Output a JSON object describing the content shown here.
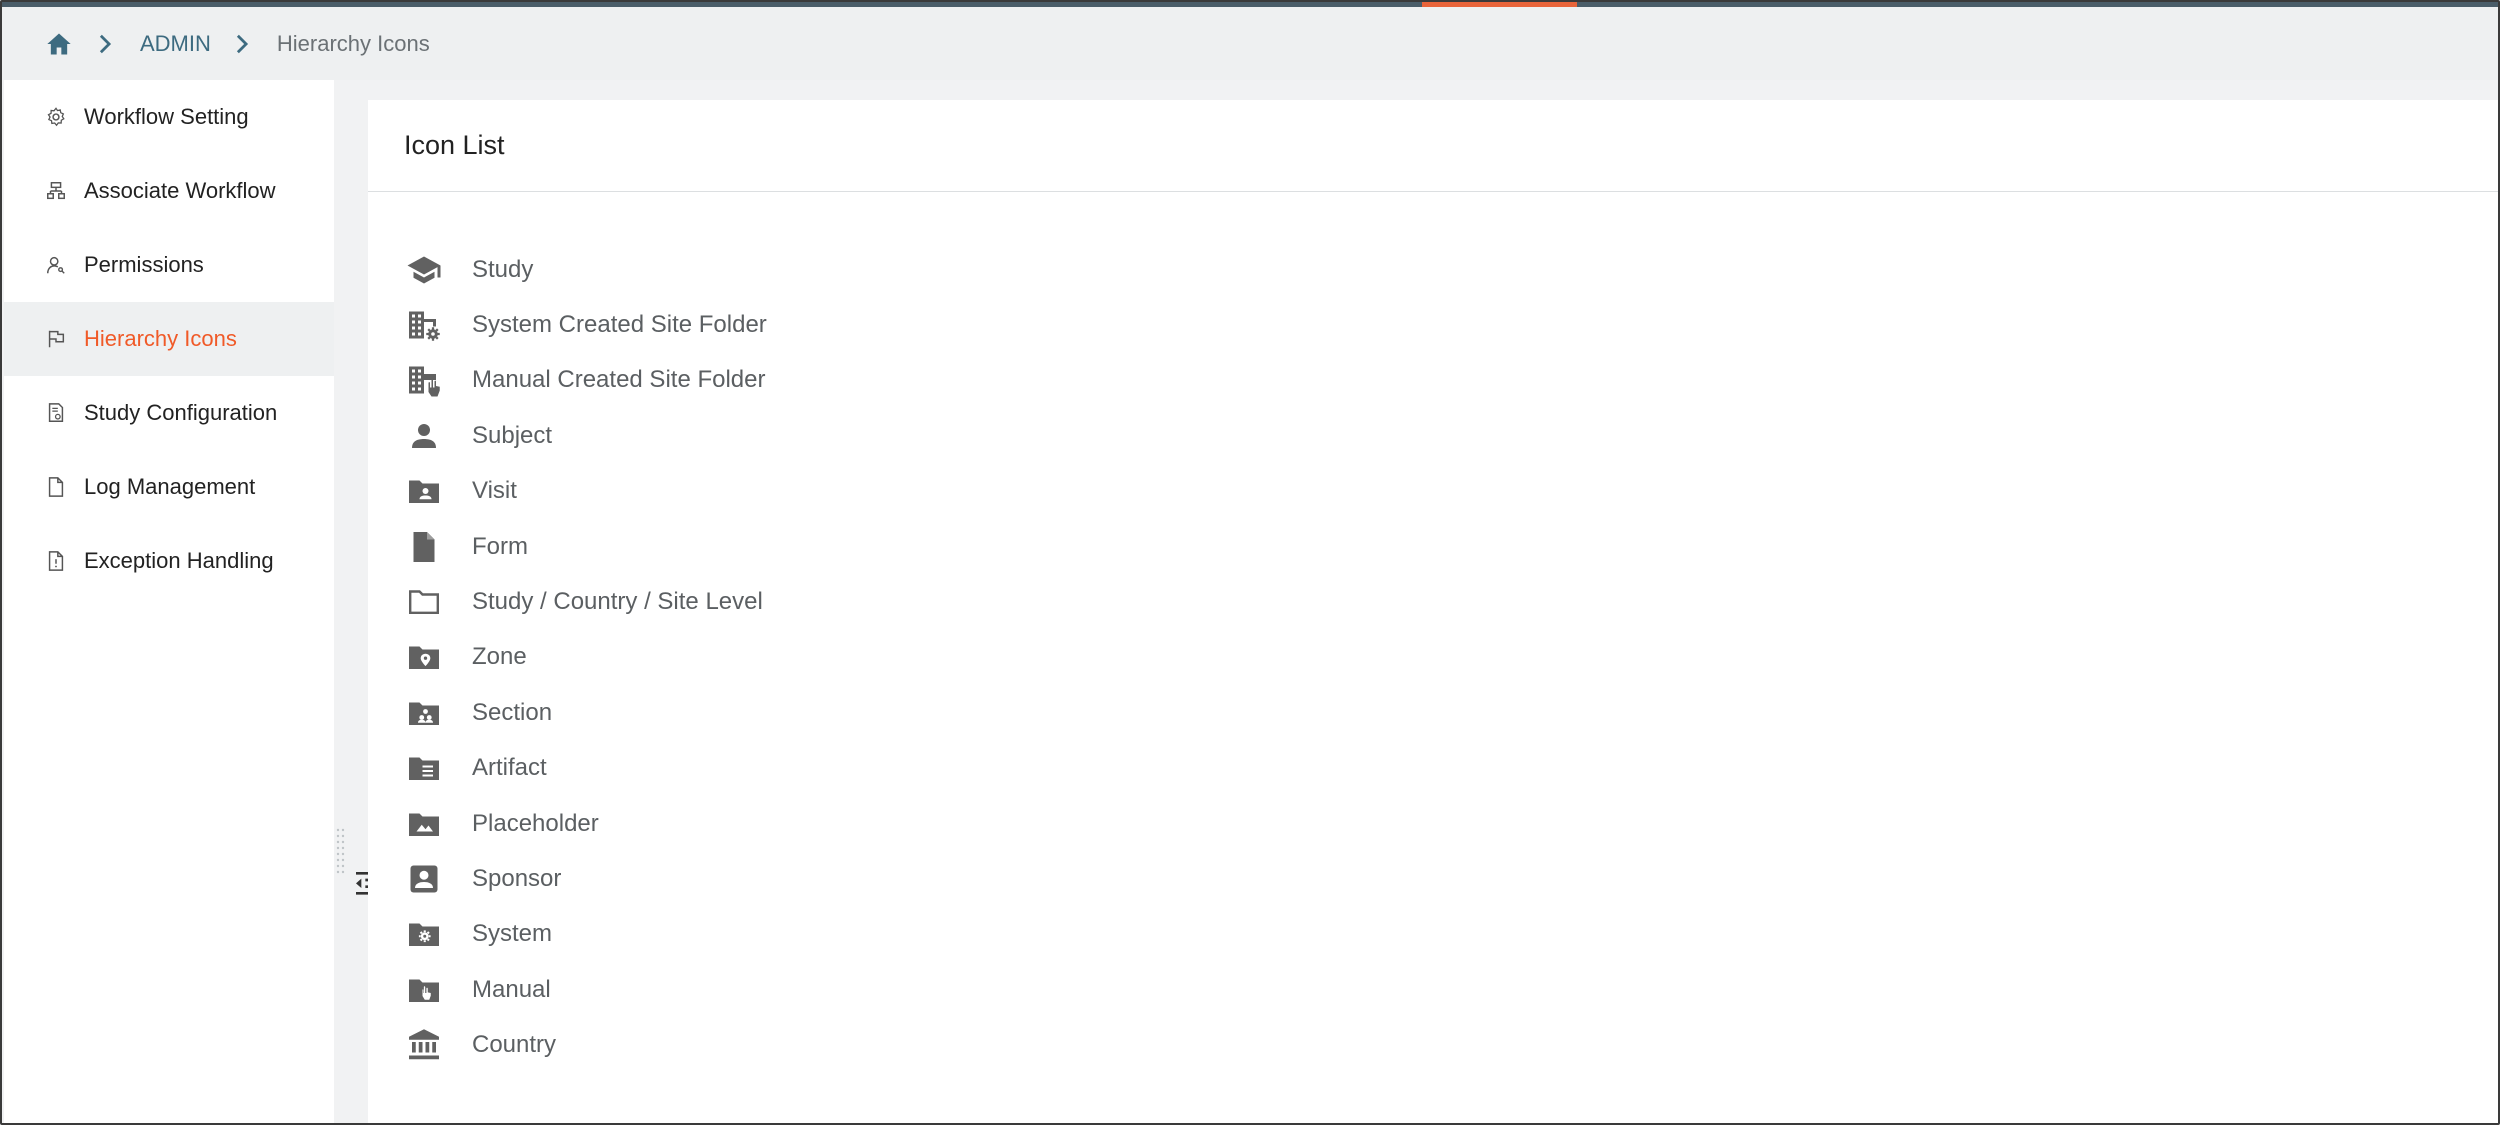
{
  "breadcrumb": {
    "home_icon": "home-icon",
    "items": [
      "ADMIN",
      "Hierarchy Icons"
    ]
  },
  "sidebar": {
    "items": [
      {
        "label": "Workflow Setting",
        "icon": "gear-icon"
      },
      {
        "label": "Associate Workflow",
        "icon": "hierarchy-icon"
      },
      {
        "label": "Permissions",
        "icon": "user-key-icon"
      },
      {
        "label": "Hierarchy Icons",
        "icon": "flag-icon",
        "active": true
      },
      {
        "label": "Study Configuration",
        "icon": "document-settings-icon"
      },
      {
        "label": "Log Management",
        "icon": "file-icon"
      },
      {
        "label": "Exception Handling",
        "icon": "file-alert-icon"
      }
    ]
  },
  "main": {
    "title": "Icon List",
    "icons": [
      {
        "label": "Study",
        "icon": "graduation-cap-icon"
      },
      {
        "label": "System Created Site Folder",
        "icon": "building-gear-icon"
      },
      {
        "label": "Manual Created Site Folder",
        "icon": "building-hand-icon"
      },
      {
        "label": "Subject",
        "icon": "person-icon"
      },
      {
        "label": "Visit",
        "icon": "folder-person-icon"
      },
      {
        "label": "Form",
        "icon": "document-icon"
      },
      {
        "label": "Study / Country / Site Level",
        "icon": "folder-outline-icon"
      },
      {
        "label": "Zone",
        "icon": "folder-pin-icon"
      },
      {
        "label": "Section",
        "icon": "folder-group-icon"
      },
      {
        "label": "Artifact",
        "icon": "folder-list-icon"
      },
      {
        "label": "Placeholder",
        "icon": "folder-image-icon"
      },
      {
        "label": "Sponsor",
        "icon": "account-box-icon"
      },
      {
        "label": "System",
        "icon": "folder-gear-icon"
      },
      {
        "label": "Manual",
        "icon": "folder-hand-icon"
      },
      {
        "label": "Country",
        "icon": "bank-icon"
      }
    ]
  },
  "colors": {
    "accent": "#f05a28",
    "link": "#3d6b80",
    "icon": "#616161"
  }
}
